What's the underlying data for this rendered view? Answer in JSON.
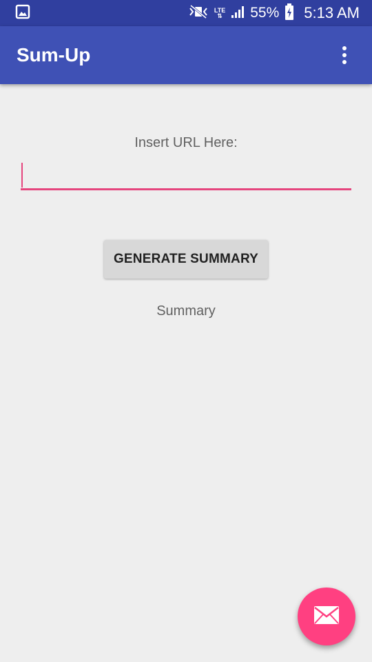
{
  "status_bar": {
    "network": "LTE",
    "battery": "55%",
    "time": "5:13 AM",
    "icons": [
      "gallery-icon",
      "mute-vibrate-icon",
      "lte-icon",
      "signal-icon",
      "battery-charging-icon"
    ]
  },
  "app_bar": {
    "title": "Sum-Up",
    "overflow_icon": "more-vert-icon"
  },
  "main": {
    "url_label": "Insert URL Here:",
    "url_value": "",
    "generate_button_label": "GENERATE SUMMARY",
    "summary_text": "Summary"
  },
  "fab": {
    "icon": "email-icon"
  },
  "colors": {
    "status_bar": "#303f9f",
    "app_bar": "#3f51b5",
    "accent": "#ff4081",
    "input_underline": "#e5457d",
    "background": "#eeeeee"
  }
}
